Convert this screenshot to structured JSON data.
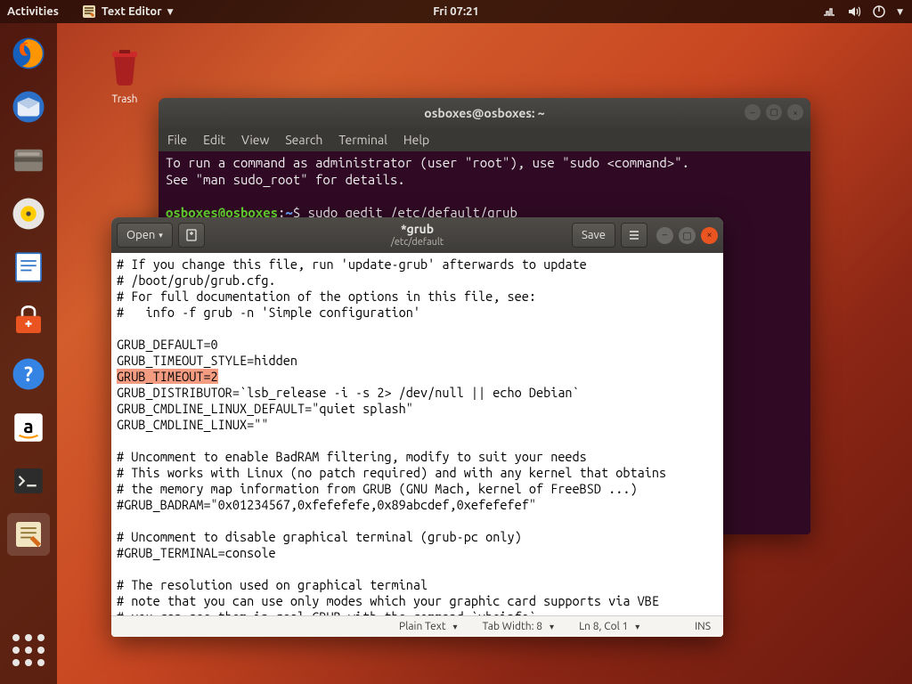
{
  "topbar": {
    "activities": "Activities",
    "app_name": "Text Editor",
    "clock": "Fri 07:21"
  },
  "desktop": {
    "trash_label": "Trash"
  },
  "terminal": {
    "title": "osboxes@osboxes: ~",
    "menu": {
      "file": "File",
      "edit": "Edit",
      "view": "View",
      "search": "Search",
      "terminal": "Terminal",
      "help": "Help"
    },
    "line1": "To run a command as administrator (user \"root\"), use \"sudo <command>\".",
    "line2": "See \"man sudo_root\" for details.",
    "prompt_user": "osboxes@osboxes",
    "prompt_sep": ":",
    "prompt_path": "~",
    "prompt_end": "$",
    "command": "sudo gedit /etc/default/grub"
  },
  "gedit": {
    "open": "Open",
    "save": "Save",
    "title": "*grub",
    "subtitle": "/etc/default",
    "status": {
      "syntax": "Plain Text",
      "tabwidth": "Tab Width: 8",
      "pos": "Ln 8, Col 1",
      "ins": "INS"
    },
    "lines": [
      "# If you change this file, run 'update-grub' afterwards to update",
      "# /boot/grub/grub.cfg.",
      "# For full documentation of the options in this file, see:",
      "#   info -f grub -n 'Simple configuration'",
      "",
      "GRUB_DEFAULT=0",
      "GRUB_TIMEOUT_STYLE=hidden",
      "GRUB_TIMEOUT=2",
      "GRUB_DISTRIBUTOR=`lsb_release -i -s 2> /dev/null || echo Debian`",
      "GRUB_CMDLINE_LINUX_DEFAULT=\"quiet splash\"",
      "GRUB_CMDLINE_LINUX=\"\"",
      "",
      "# Uncomment to enable BadRAM filtering, modify to suit your needs",
      "# This works with Linux (no patch required) and with any kernel that obtains",
      "# the memory map information from GRUB (GNU Mach, kernel of FreeBSD ...)",
      "#GRUB_BADRAM=\"0x01234567,0xfefefefe,0x89abcdef,0xefefefef\"",
      "",
      "# Uncomment to disable graphical terminal (grub-pc only)",
      "#GRUB_TERMINAL=console",
      "",
      "# The resolution used on graphical terminal",
      "# note that you can use only modes which your graphic card supports via VBE",
      "# you can see them in real GRUB with the command `vbeinfo`"
    ],
    "selected_line_index": 7
  }
}
